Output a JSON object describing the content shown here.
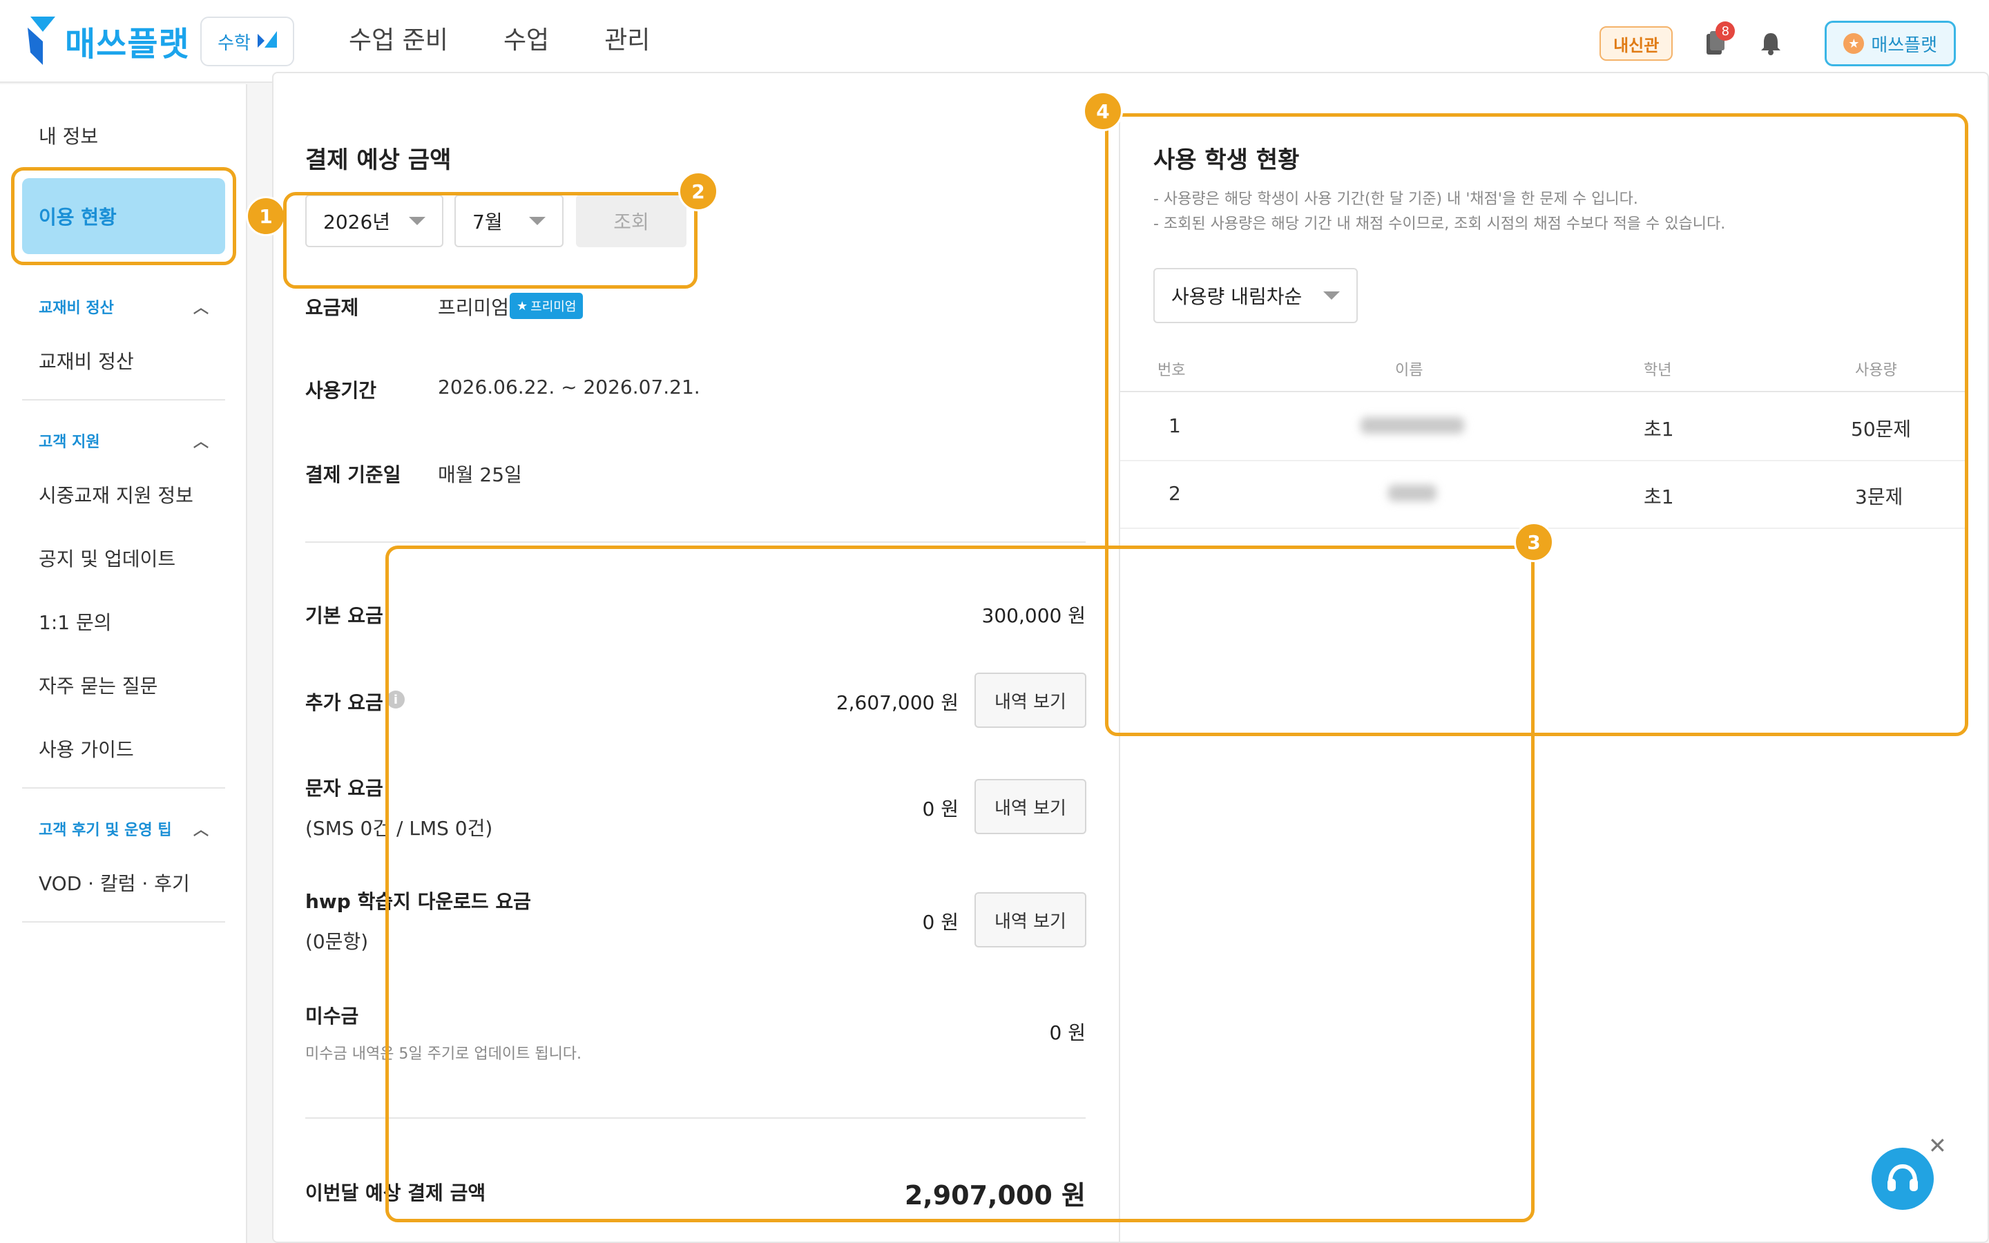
{
  "header": {
    "logo_text": "매쓰플랫",
    "subject": "수학",
    "nav": [
      "수업 준비",
      "수업",
      "관리"
    ],
    "naesin_badge": "내신관",
    "notification_count": "8",
    "profile_label": "매쓰플랫"
  },
  "sidebar": {
    "my_info": "내 정보",
    "usage_status": "이용 현황",
    "section_textbook": "교재비 정산",
    "textbook_settlement": "교재비 정산",
    "section_support": "고객 지원",
    "support_items": [
      "시중교재 지원 정보",
      "공지 및 업데이트",
      "1:1 문의",
      "자주 묻는 질문",
      "사용 가이드"
    ],
    "section_reviews": "고객 후기 및 운영 팁",
    "reviews_item": "VOD · 칼럼 · 후기"
  },
  "billing": {
    "title": "결제 예상 금액",
    "year": "2026년",
    "month": "7월",
    "query_button": "조회",
    "plan_label": "요금제",
    "plan_value": "프리미엄",
    "plan_badge": "프리미엄",
    "period_label": "사용기간",
    "period_value": "2026.06.22. ~ 2026.07.21.",
    "billing_day_label": "결제 기준일",
    "billing_day_value": "매월 25일",
    "base_fee_label": "기본 요금",
    "base_fee_value": "300,000 원",
    "extra_fee_label": "추가 요금",
    "extra_fee_value": "2,607,000 원",
    "sms_fee_label": "문자 요금",
    "sms_fee_sub": "(SMS 0건 / LMS 0건)",
    "sms_fee_value": "0 원",
    "hwp_fee_label": "hwp 학습지 다운로드 요금",
    "hwp_fee_sub": "(0문항)",
    "hwp_fee_value": "0 원",
    "unpaid_label": "미수금",
    "unpaid_note": "미수금 내역은 5일 주기로 업데이트 됩니다.",
    "unpaid_value": "0 원",
    "detail_button": "내역 보기",
    "total_label": "이번달 예상 결제 금액",
    "total_value": "2,907,000 원"
  },
  "students": {
    "title": "사용 학생 현황",
    "note1": "- 사용량은 해당 학생이 사용 기간(한 달 기준) 내 '채점'을 한 문제 수 입니다.",
    "note2": "- 조회된 사용량은 해당 기간 내 채점 수이므로, 조회 시점의 채점 수보다 적을 수 있습니다.",
    "sort": "사용량 내림차순",
    "columns": [
      "번호",
      "이름",
      "학년",
      "사용량"
    ],
    "rows": [
      {
        "no": "1",
        "name": "",
        "grade": "초1",
        "usage": "50문제"
      },
      {
        "no": "2",
        "name": "",
        "grade": "초1",
        "usage": "3문제"
      }
    ]
  },
  "annotations": [
    "1",
    "2",
    "3",
    "4"
  ],
  "colors": {
    "accent": "#1ba4ec",
    "annotation": "#efa51c",
    "active_bg": "#a7def7"
  }
}
